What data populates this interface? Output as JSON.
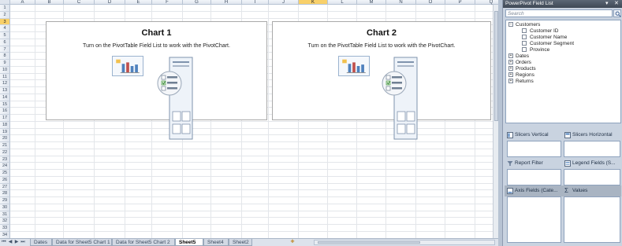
{
  "spreadsheet": {
    "columns": [
      "A",
      "B",
      "C",
      "D",
      "E",
      "F",
      "G",
      "H",
      "I",
      "J",
      "K",
      "L",
      "M",
      "N",
      "O",
      "P",
      "Q"
    ],
    "active_column": "K",
    "rows": [
      "1",
      "2",
      "3",
      "4",
      "5",
      "6",
      "7",
      "8",
      "9",
      "10",
      "11",
      "12",
      "13",
      "14",
      "15",
      "16",
      "17",
      "18",
      "19",
      "20",
      "21",
      "22",
      "23",
      "24",
      "25",
      "26",
      "27",
      "28",
      "29",
      "30",
      "31",
      "32",
      "33",
      "34"
    ],
    "active_row": "3"
  },
  "charts": [
    {
      "title": "Chart 1",
      "message": "Turn on the PivotTable Field List to work with the PivotChart."
    },
    {
      "title": "Chart 2",
      "message": "Turn on the PivotTable Field List to work with the PivotChart."
    }
  ],
  "sheet_tabs": [
    {
      "label": "Dates",
      "active": false
    },
    {
      "label": "Data for Sheet5 Chart 1",
      "active": false
    },
    {
      "label": "Data for Sheet5 Chart 2",
      "active": false
    },
    {
      "label": "Sheet5",
      "active": true
    },
    {
      "label": "Sheet4",
      "active": false
    },
    {
      "label": "Sheet2",
      "active": false
    }
  ],
  "panel": {
    "title": "PowerPivot Field List",
    "search_placeholder": "Search",
    "tables": [
      {
        "name": "Customers",
        "expanded": true,
        "fields": [
          "Customer ID",
          "Customer Name",
          "Customer Segment",
          "Province"
        ]
      },
      {
        "name": "Dates",
        "expanded": false
      },
      {
        "name": "Orders",
        "expanded": false
      },
      {
        "name": "Products",
        "expanded": false
      },
      {
        "name": "Regions",
        "expanded": false
      },
      {
        "name": "Returns",
        "expanded": false
      }
    ],
    "areas": {
      "slicers_vertical": "Slicers Vertical",
      "slicers_horizontal": "Slicers Horizontal",
      "report_filter": "Report Filter",
      "legend_fields": "Legend Fields (S...",
      "axis_fields": "Axis Fields (Cate...",
      "values": "Values"
    }
  },
  "colors": {
    "active_header": "#f8d06a",
    "panel_bg": "#c9d3e0",
    "panel_title_bg": "#3f4855"
  }
}
